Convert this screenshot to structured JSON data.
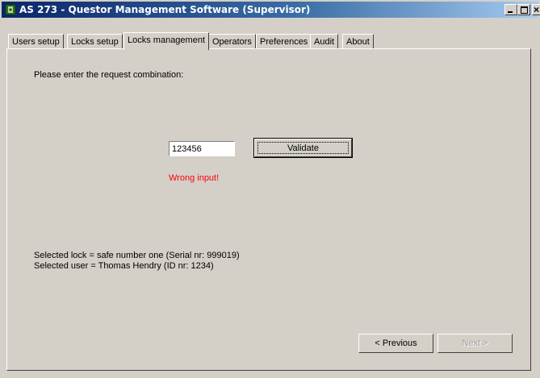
{
  "window": {
    "title": "AS 273 - Questor Management Software (Supervisor)",
    "title_bar_colors": {
      "start": "#0a246a",
      "end": "#a6caf0"
    },
    "controls": {
      "minimize": "minimize-icon",
      "maximize": "maximize-icon",
      "close": "close-icon"
    }
  },
  "tabs": [
    {
      "label": "Users setup",
      "active": false
    },
    {
      "label": "Locks setup",
      "active": false
    },
    {
      "label": "Locks management",
      "active": true
    },
    {
      "label": "Operators",
      "active": false
    },
    {
      "label": "Preferences",
      "active": false
    },
    {
      "label": "Audit",
      "active": false
    },
    {
      "label": "About",
      "active": false
    }
  ],
  "main": {
    "prompt": "Please enter the request combination:",
    "combination_value": "123456",
    "validate_label": "Validate",
    "error_message": "Wrong input!",
    "error_color": "#ff0000",
    "selected_lock": "Selected lock = safe number one (Serial nr: 999019)",
    "selected_user": "Selected user = Thomas Hendry (ID nr: 1234)",
    "previous_label": "< Previous",
    "next_label": "Next >",
    "next_enabled": false
  }
}
